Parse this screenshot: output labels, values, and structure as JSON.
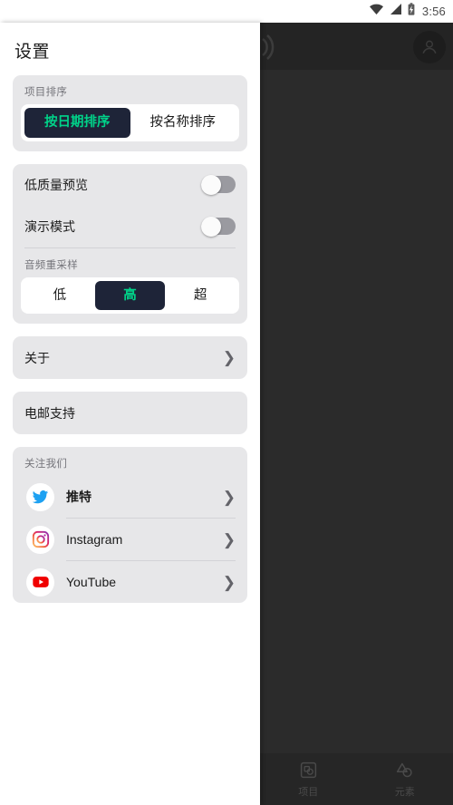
{
  "statusbar": {
    "time": "3:56",
    "icons": [
      "wifi-icon",
      "signal-icon",
      "battery-charging-icon"
    ]
  },
  "background_app": {
    "brand_icon": "soundwave-logo-icon",
    "avatar_icon": "account-avatar-icon",
    "bottom_nav": [
      {
        "label": "项目",
        "icon": "projects-icon"
      },
      {
        "label": "元素",
        "icon": "elements-icon"
      }
    ]
  },
  "drawer": {
    "title": "设置",
    "sections": {
      "project_sort": {
        "label": "项目排序",
        "options": [
          "按日期排序",
          "按名称排序"
        ],
        "selected": 0
      },
      "toggles": {
        "items": [
          {
            "label": "低质量预览",
            "value": "off"
          },
          {
            "label": "演示模式",
            "value": "off"
          }
        ],
        "audio_label": "音频重采样",
        "audio_options": [
          "低",
          "高",
          "超"
        ],
        "audio_selected": 1
      },
      "about": {
        "label": "关于",
        "chevron": "chevron-right-icon"
      },
      "email": {
        "label": "电邮支持"
      },
      "follow": {
        "label": "关注我们",
        "items": [
          {
            "label": "推特",
            "icon": "twitter-icon",
            "chevron": "chevron-right-icon"
          },
          {
            "label": "Instagram",
            "icon": "instagram-icon",
            "chevron": "chevron-right-icon"
          },
          {
            "label": "YouTube",
            "icon": "youtube-icon",
            "chevron": "chevron-right-icon"
          }
        ]
      }
    }
  },
  "colors": {
    "accent_green": "#00d389",
    "segment_active_bg": "#1e2438",
    "card_bg": "#e7e7e9",
    "scrim": "#2b2b2b"
  }
}
